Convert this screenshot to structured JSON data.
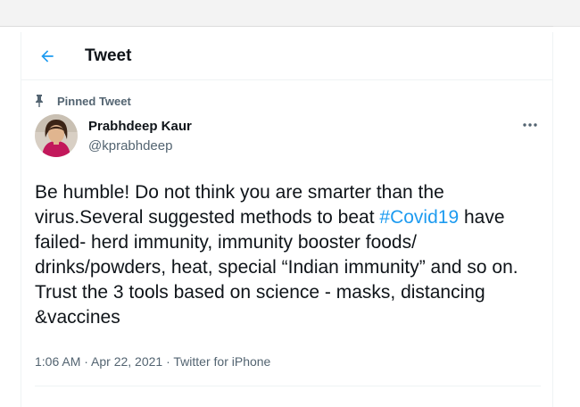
{
  "header": {
    "back_icon": "arrow-left-icon",
    "title": "Tweet"
  },
  "pinned": {
    "icon": "pin-icon",
    "label": "Pinned Tweet"
  },
  "author": {
    "name": "Prabhdeep Kaur",
    "handle": "@kprabhdeep",
    "more_icon": "more-horizontal-icon"
  },
  "tweet": {
    "text_before": "Be humble! Do not think you are smarter than the virus.Several suggested methods to beat ",
    "hashtag": "#Covid19",
    "text_after": " have failed- herd immunity, immunity booster foods/ drinks/powders, heat, special “Indian immunity” and so on. Trust the 3 tools based on science - masks, distancing &vaccines",
    "meta": "1:06 AM · Apr 22, 2021 · Twitter for iPhone"
  },
  "colors": {
    "accent": "#1d9bf0",
    "text": "#0f1419",
    "secondary": "#536471"
  }
}
